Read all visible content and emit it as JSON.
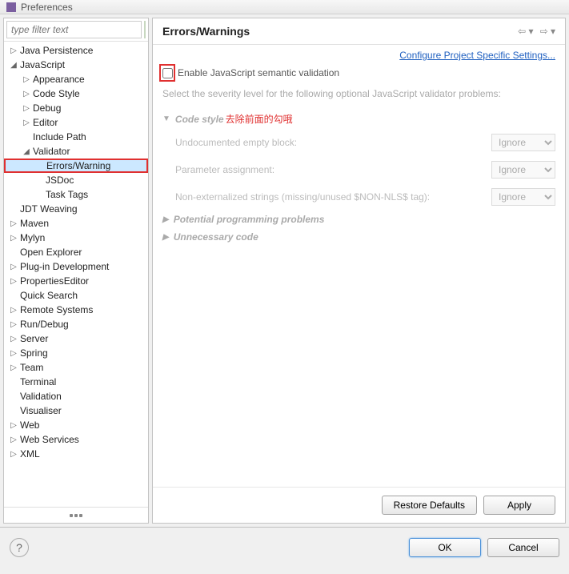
{
  "title": "Preferences",
  "filter_placeholder": "type filter text",
  "tree": [
    {
      "label": "Java Persistence",
      "depth": 1,
      "exp": "▷"
    },
    {
      "label": "JavaScript",
      "depth": 1,
      "exp": "◢"
    },
    {
      "label": "Appearance",
      "depth": 2,
      "exp": "▷"
    },
    {
      "label": "Code Style",
      "depth": 2,
      "exp": "▷"
    },
    {
      "label": "Debug",
      "depth": 2,
      "exp": "▷"
    },
    {
      "label": "Editor",
      "depth": 2,
      "exp": "▷"
    },
    {
      "label": "Include Path",
      "depth": 2,
      "exp": ""
    },
    {
      "label": "Validator",
      "depth": 2,
      "exp": "◢"
    },
    {
      "label": "Errors/Warning",
      "depth": 3,
      "exp": "",
      "selected": true,
      "hl": true
    },
    {
      "label": "JSDoc",
      "depth": 3,
      "exp": ""
    },
    {
      "label": "Task Tags",
      "depth": 3,
      "exp": ""
    },
    {
      "label": "JDT Weaving",
      "depth": 1,
      "exp": ""
    },
    {
      "label": "Maven",
      "depth": 1,
      "exp": "▷"
    },
    {
      "label": "Mylyn",
      "depth": 1,
      "exp": "▷"
    },
    {
      "label": "Open Explorer",
      "depth": 1,
      "exp": ""
    },
    {
      "label": "Plug-in Development",
      "depth": 1,
      "exp": "▷"
    },
    {
      "label": "PropertiesEditor",
      "depth": 1,
      "exp": "▷"
    },
    {
      "label": "Quick Search",
      "depth": 1,
      "exp": ""
    },
    {
      "label": "Remote Systems",
      "depth": 1,
      "exp": "▷"
    },
    {
      "label": "Run/Debug",
      "depth": 1,
      "exp": "▷"
    },
    {
      "label": "Server",
      "depth": 1,
      "exp": "▷"
    },
    {
      "label": "Spring",
      "depth": 1,
      "exp": "▷"
    },
    {
      "label": "Team",
      "depth": 1,
      "exp": "▷"
    },
    {
      "label": "Terminal",
      "depth": 1,
      "exp": ""
    },
    {
      "label": "Validation",
      "depth": 1,
      "exp": ""
    },
    {
      "label": "Visualiser",
      "depth": 1,
      "exp": ""
    },
    {
      "label": "Web",
      "depth": 1,
      "exp": "▷"
    },
    {
      "label": "Web Services",
      "depth": 1,
      "exp": "▷"
    },
    {
      "label": "XML",
      "depth": 1,
      "exp": "▷"
    }
  ],
  "header": {
    "title": "Errors/Warnings"
  },
  "link": "Configure Project Specific Settings...",
  "checkbox_label": "Enable JavaScript semantic validation",
  "description": "Select the severity level for the following optional JavaScript validator problems:",
  "annotation": "去除前面的勾哦",
  "sections": {
    "code_style": {
      "label": "Code style",
      "options": [
        {
          "label": "Undocumented empty block:",
          "value": "Ignore"
        },
        {
          "label": "Parameter assignment:",
          "value": "Ignore"
        },
        {
          "label": "Non-externalized strings (missing/unused $NON-NLS$ tag):",
          "value": "Ignore"
        }
      ]
    },
    "potential": {
      "label": "Potential programming problems"
    },
    "unnecessary": {
      "label": "Unnecessary code"
    }
  },
  "buttons": {
    "restore": "Restore Defaults",
    "apply": "Apply",
    "ok": "OK",
    "cancel": "Cancel"
  }
}
